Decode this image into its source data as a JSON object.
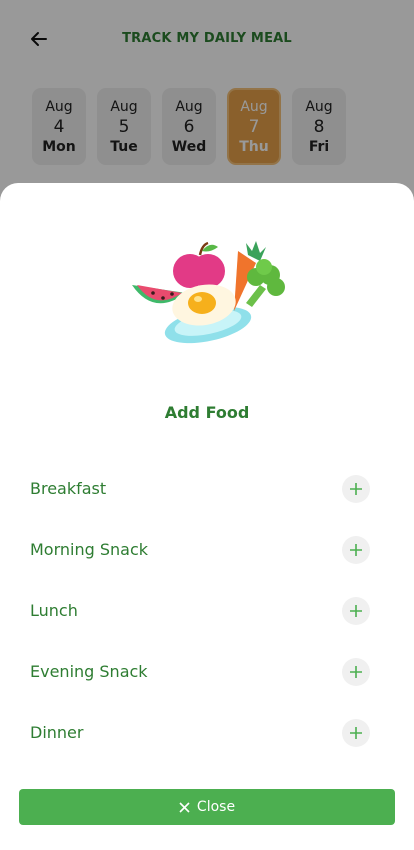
{
  "header": {
    "title": "TRACK MY DAILY MEAL",
    "back_icon": "arrow-left-icon"
  },
  "dates": [
    {
      "month": "Aug",
      "day": "4",
      "weekday": "Mon",
      "selected": false
    },
    {
      "month": "Aug",
      "day": "5",
      "weekday": "Tue",
      "selected": false
    },
    {
      "month": "Aug",
      "day": "6",
      "weekday": "Wed",
      "selected": false
    },
    {
      "month": "Aug",
      "day": "7",
      "weekday": "Thu",
      "selected": true
    },
    {
      "month": "Aug",
      "day": "8",
      "weekday": "Fri",
      "selected": false
    }
  ],
  "sheet": {
    "illustration_icon": "food-plate-icon",
    "title": "Add Food",
    "meals": [
      {
        "label": "Breakfast",
        "icon": "plus-icon"
      },
      {
        "label": "Morning Snack",
        "icon": "plus-icon"
      },
      {
        "label": "Lunch",
        "icon": "plus-icon"
      },
      {
        "label": "Evening Snack",
        "icon": "plus-icon"
      },
      {
        "label": "Dinner",
        "icon": "plus-icon"
      }
    ],
    "close_label": "Close",
    "close_icon": "close-icon"
  },
  "colors": {
    "primary_green": "#2e7d32",
    "button_green": "#4caf50",
    "selected_date": "#e6a14a"
  }
}
